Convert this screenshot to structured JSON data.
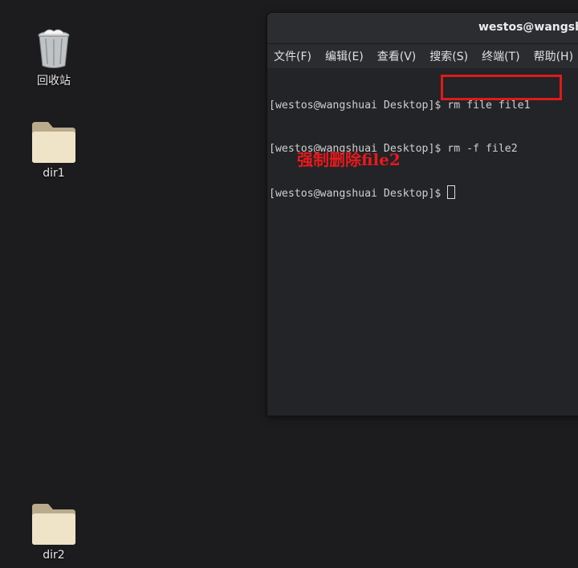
{
  "desktop": {
    "icons": [
      {
        "label": "回收站",
        "icon": "trash-icon"
      },
      {
        "label": "dir1",
        "icon": "folder-icon"
      },
      {
        "label": "dir2",
        "icon": "folder-icon"
      }
    ]
  },
  "terminal": {
    "title": "westos@wangshuai:~/Desktop",
    "menu": [
      "文件(F)",
      "编辑(E)",
      "查看(V)",
      "搜索(S)",
      "终端(T)",
      "帮助(H)"
    ],
    "lines": [
      "[westos@wangshuai Desktop]$ rm file file1",
      "[westos@wangshuai Desktop]$ rm -f file2",
      "[westos@wangshuai Desktop]$ "
    ]
  },
  "annotation": {
    "text": "强制删除file2",
    "color": "#e8191c"
  },
  "colors": {
    "desktop_bg": "#1c1c1e",
    "terminal_bg": "#222427",
    "highlight": "#e01a1a"
  }
}
